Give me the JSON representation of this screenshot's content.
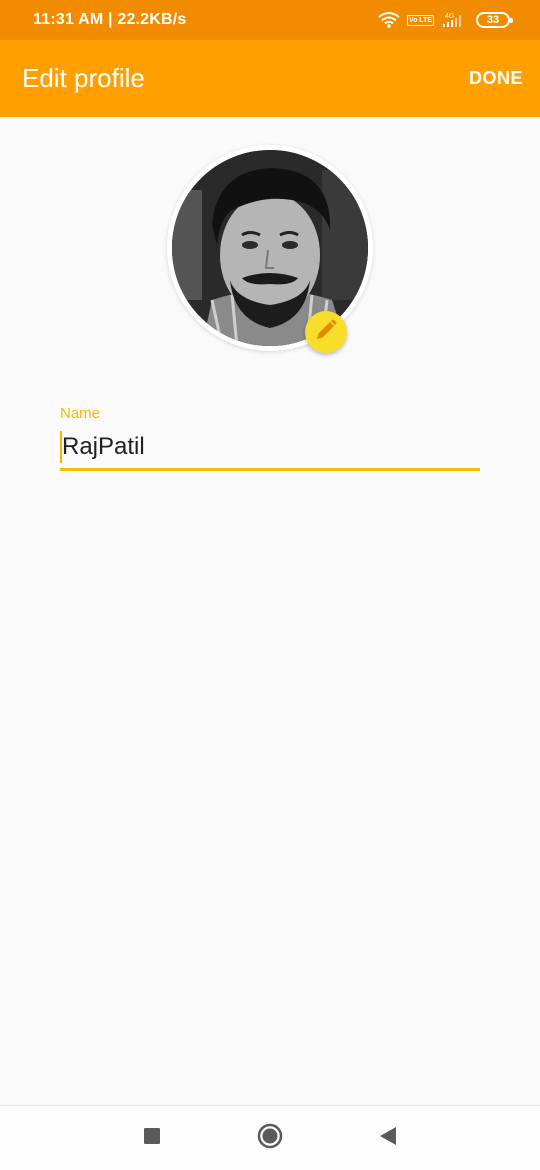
{
  "status_bar": {
    "time_speed": "11:31 AM | 22.2KB/s",
    "volte_label": "Vo LTE",
    "network": "4G",
    "battery": "33"
  },
  "app_bar": {
    "title": "Edit profile",
    "done_label": "DONE"
  },
  "profile": {
    "avatar_icon": "profile-photo",
    "edit_icon": "pencil-icon"
  },
  "form": {
    "name_label": "Name",
    "name_value": "RajPatil"
  },
  "colors": {
    "status_bar": "#f18c00",
    "app_bar": "#ffa000",
    "accent": "#f5b800",
    "edit_button": "#f9dd2b"
  },
  "nav": {
    "recents_icon": "square-icon",
    "home_icon": "circle-icon",
    "back_icon": "triangle-back-icon"
  }
}
